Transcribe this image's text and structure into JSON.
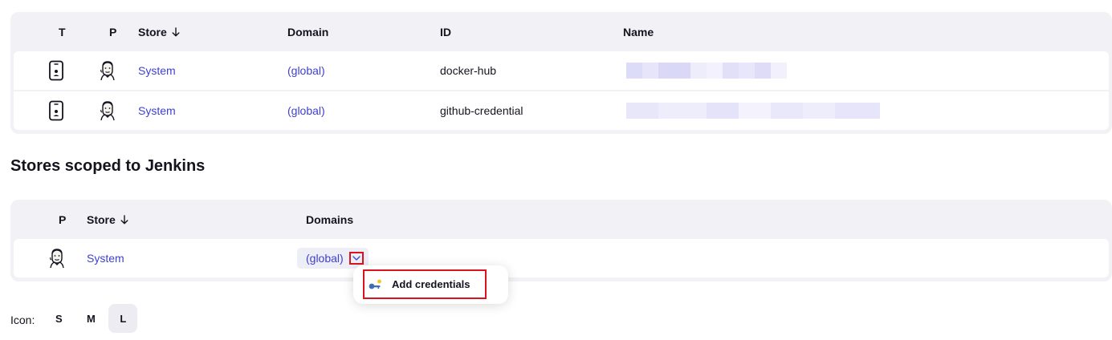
{
  "credentials_table": {
    "headers": {
      "t": "T",
      "p": "P",
      "store": "Store",
      "domain": "Domain",
      "id": "ID",
      "name": "Name"
    },
    "rows": [
      {
        "store": "System",
        "domain": "(global)",
        "id": "docker-hub",
        "name": ""
      },
      {
        "store": "System",
        "domain": "(global)",
        "id": "github-credential",
        "name": ""
      }
    ]
  },
  "stores_section": {
    "title": "Stores scoped to Jenkins",
    "headers": {
      "p": "P",
      "store": "Store",
      "domains": "Domains"
    },
    "rows": [
      {
        "store": "System",
        "domain": "(global)"
      }
    ]
  },
  "domain_menu": {
    "items": [
      {
        "label": "Add credentials",
        "icon": "key-icon"
      }
    ]
  },
  "icon_size": {
    "label": "Icon:",
    "options": [
      "S",
      "M",
      "L"
    ],
    "selected": "L"
  },
  "colors": {
    "link": "#3f40d0",
    "highlight_border": "#d9141e",
    "panel_bg": "#f2f1f6",
    "blur_name": "#d9d8f7"
  }
}
